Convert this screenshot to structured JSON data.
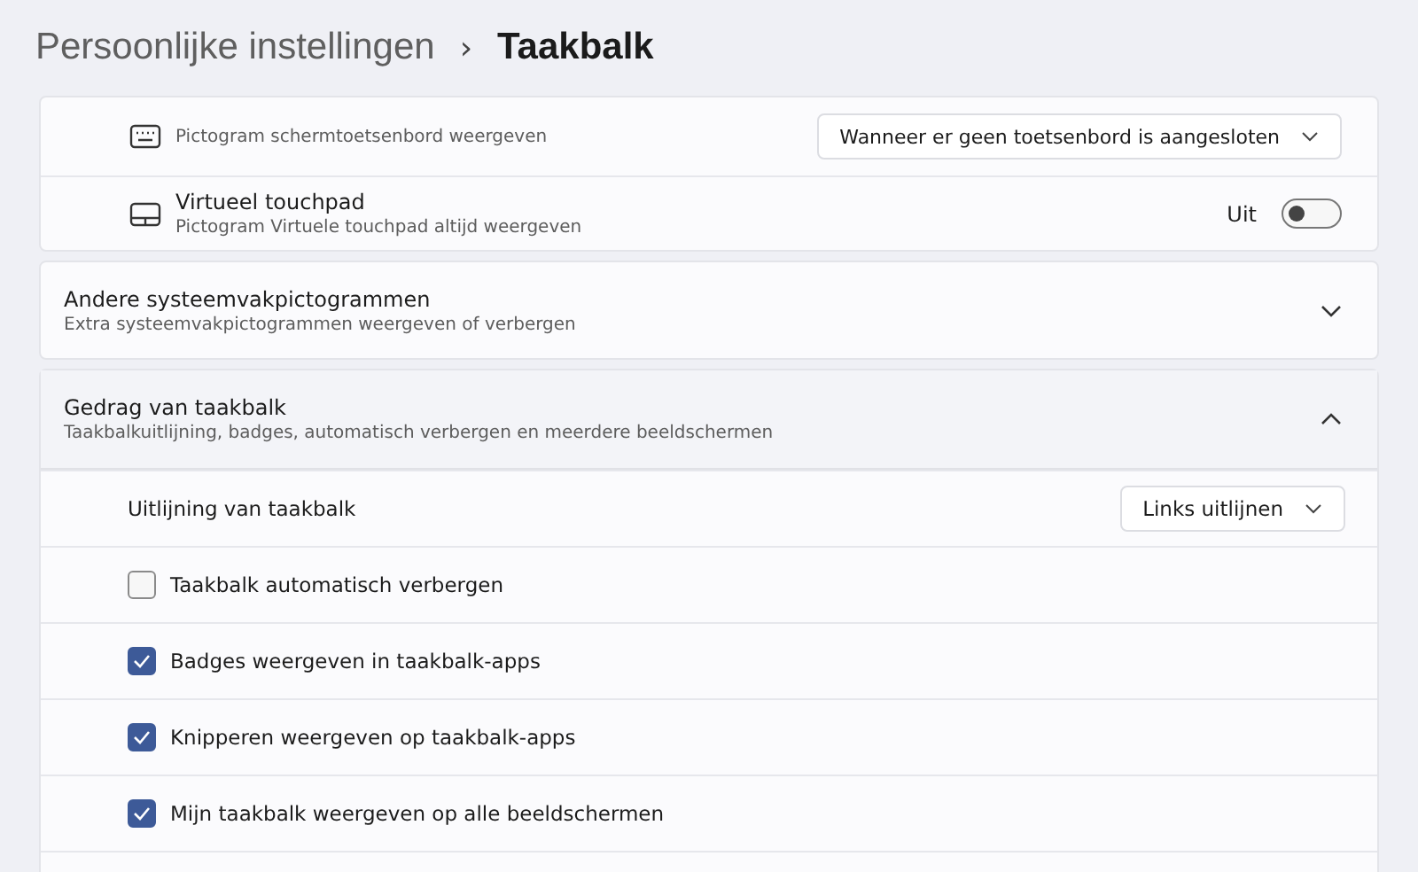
{
  "breadcrumb": {
    "parent": "Persoonlijke instellingen",
    "separator": "›",
    "current": "Taakbalk"
  },
  "tray_rows": [
    {
      "kind": "dropdown",
      "subtitle": "Pictogram schermtoetsenbord weergeven",
      "value": "Wanneer er geen toetsenbord is aangesloten"
    },
    {
      "kind": "toggle",
      "title": "Virtueel touchpad",
      "subtitle": "Pictogram Virtuele touchpad altijd weergeven",
      "on": false,
      "state_label": "Uit"
    }
  ],
  "sections": [
    {
      "title": "Andere systeemvakpictogrammen",
      "subtitle": "Extra systeemvakpictogrammen weergeven of verbergen",
      "expanded": false
    },
    {
      "title": "Gedrag van taakbalk",
      "subtitle": "Taakbalkuitlijning, badges, automatisch verbergen en meerdere beeldschermen",
      "expanded": true,
      "items": [
        {
          "kind": "dropdown",
          "label": "Uitlijning van taakbalk",
          "value": "Links uitlijnen"
        },
        {
          "kind": "checkbox",
          "label": "Taakbalk automatisch verbergen",
          "checked": false
        },
        {
          "kind": "checkbox",
          "label": "Badges weergeven in taakbalk-apps",
          "checked": true
        },
        {
          "kind": "checkbox",
          "label": "Knipperen weergeven op taakbalk-apps",
          "checked": true
        },
        {
          "kind": "checkbox",
          "label": "Mijn taakbalk weergeven op alle beeldschermen",
          "checked": true
        }
      ]
    }
  ]
}
